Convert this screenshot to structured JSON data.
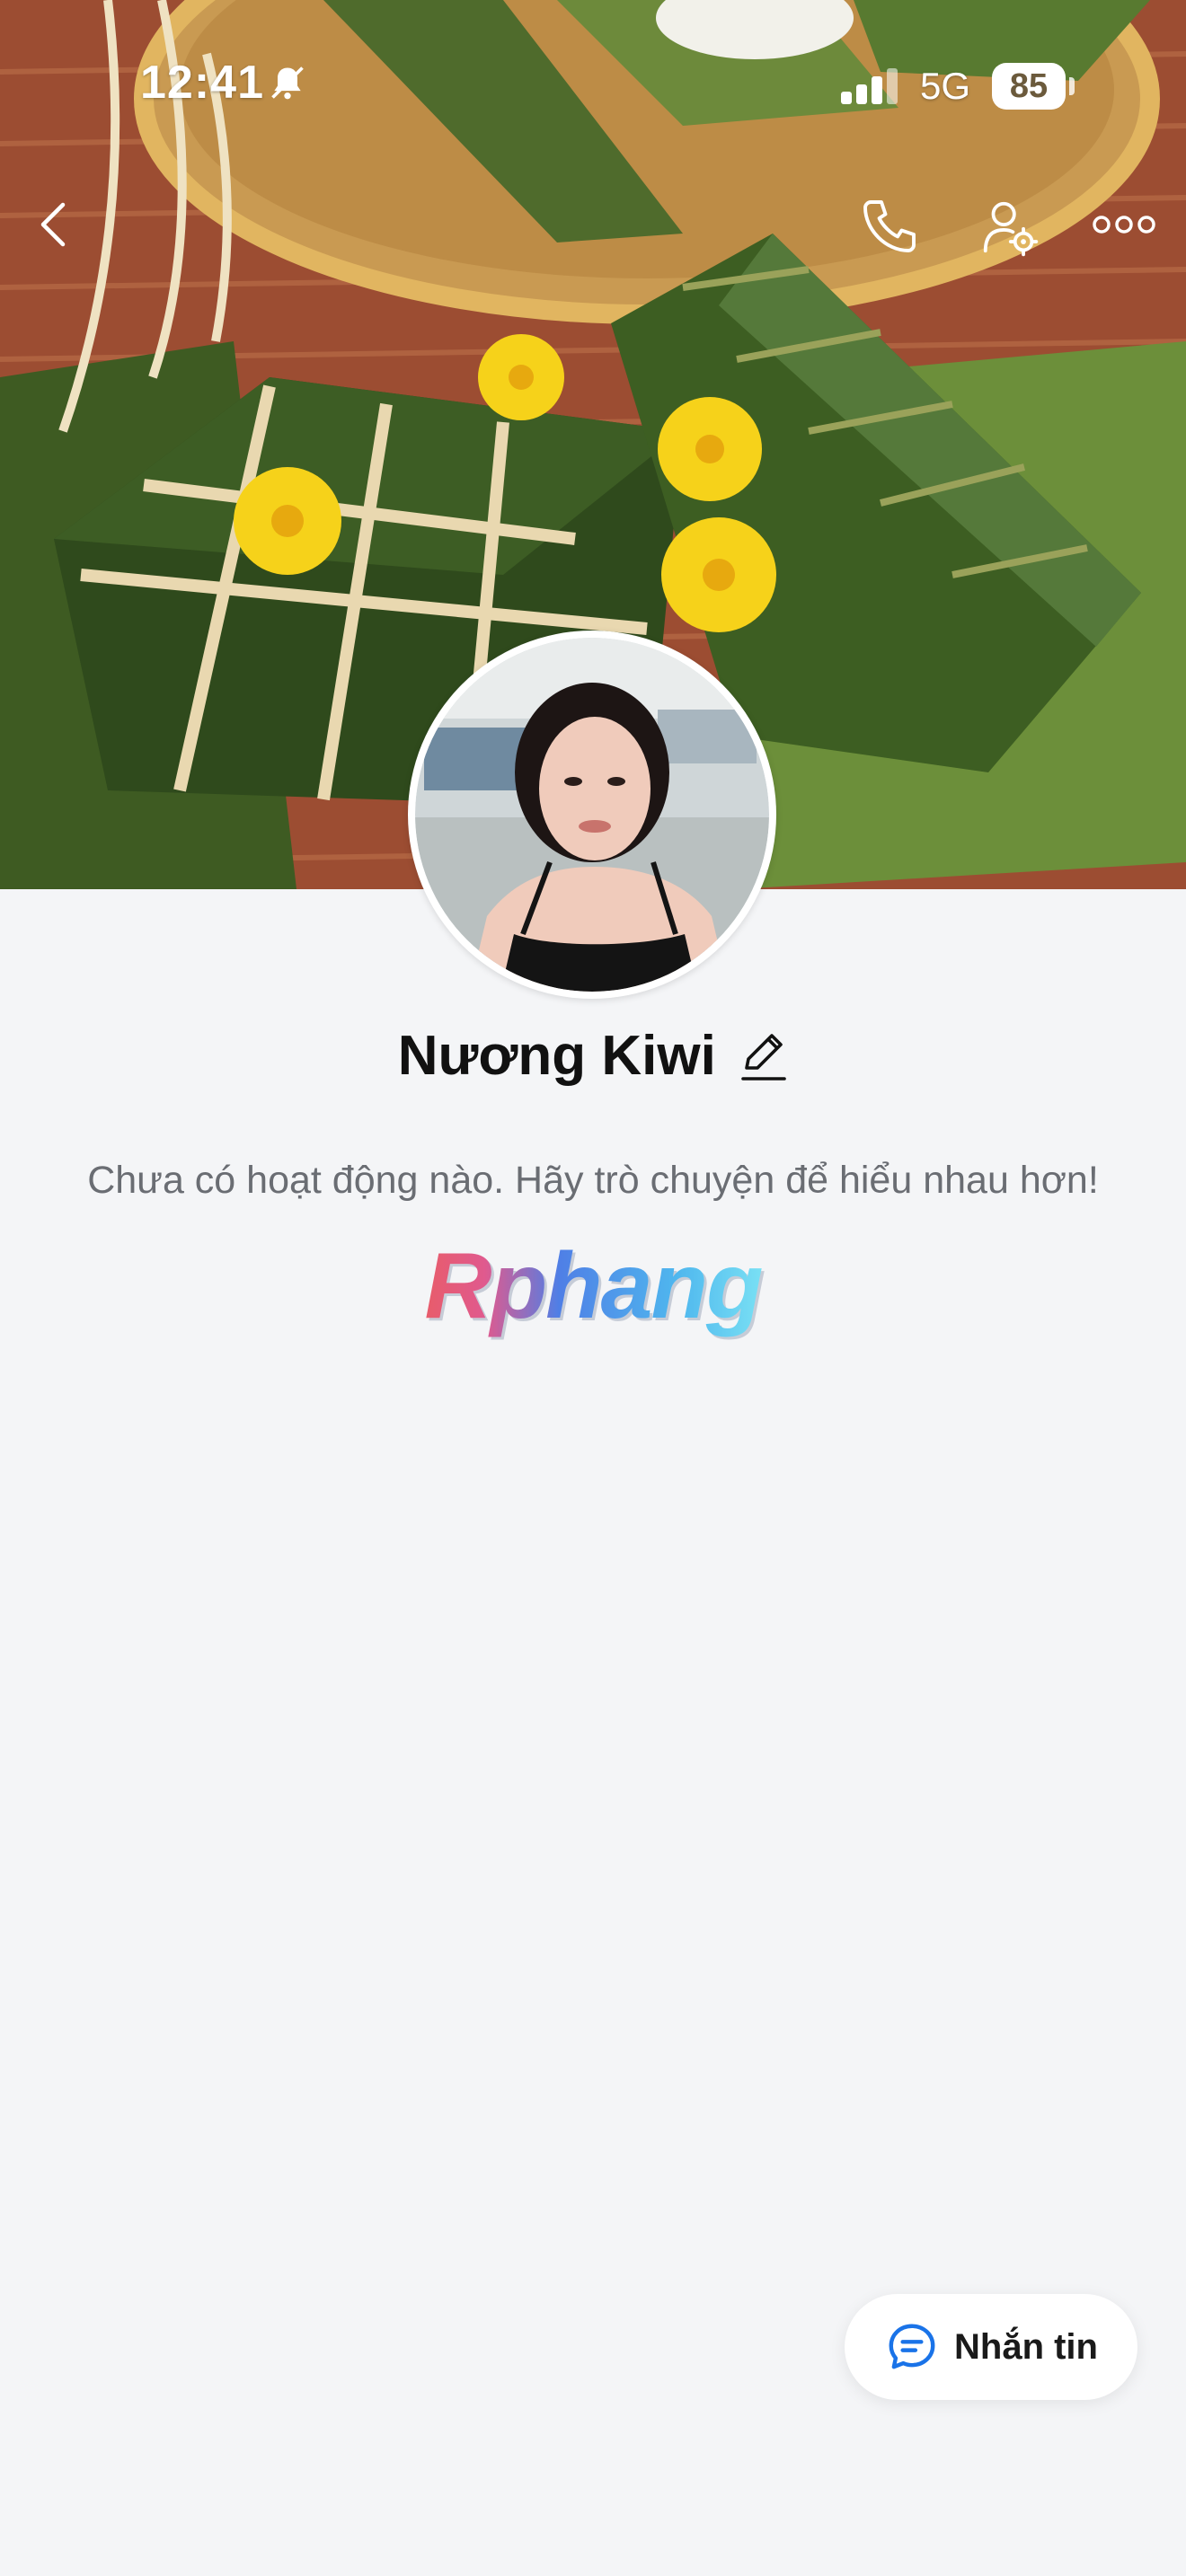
{
  "status_bar": {
    "time": "12:41",
    "network": "5G",
    "battery": "85"
  },
  "profile": {
    "name": "Nương Kiwi",
    "activity_text": "Chưa có hoạt động nào. Hãy trò chuyện để hiểu nhau hơn!",
    "watermark": "Rphang"
  },
  "nav": {
    "icons": [
      "back-icon",
      "phone-icon",
      "user-settings-icon",
      "more-icon"
    ]
  },
  "actions": {
    "message_label": "Nhắn tin"
  },
  "colors": {
    "background": "#f4f5f7",
    "accent": "#1a73e8",
    "text": "#111111",
    "muted": "#6a6d73"
  }
}
